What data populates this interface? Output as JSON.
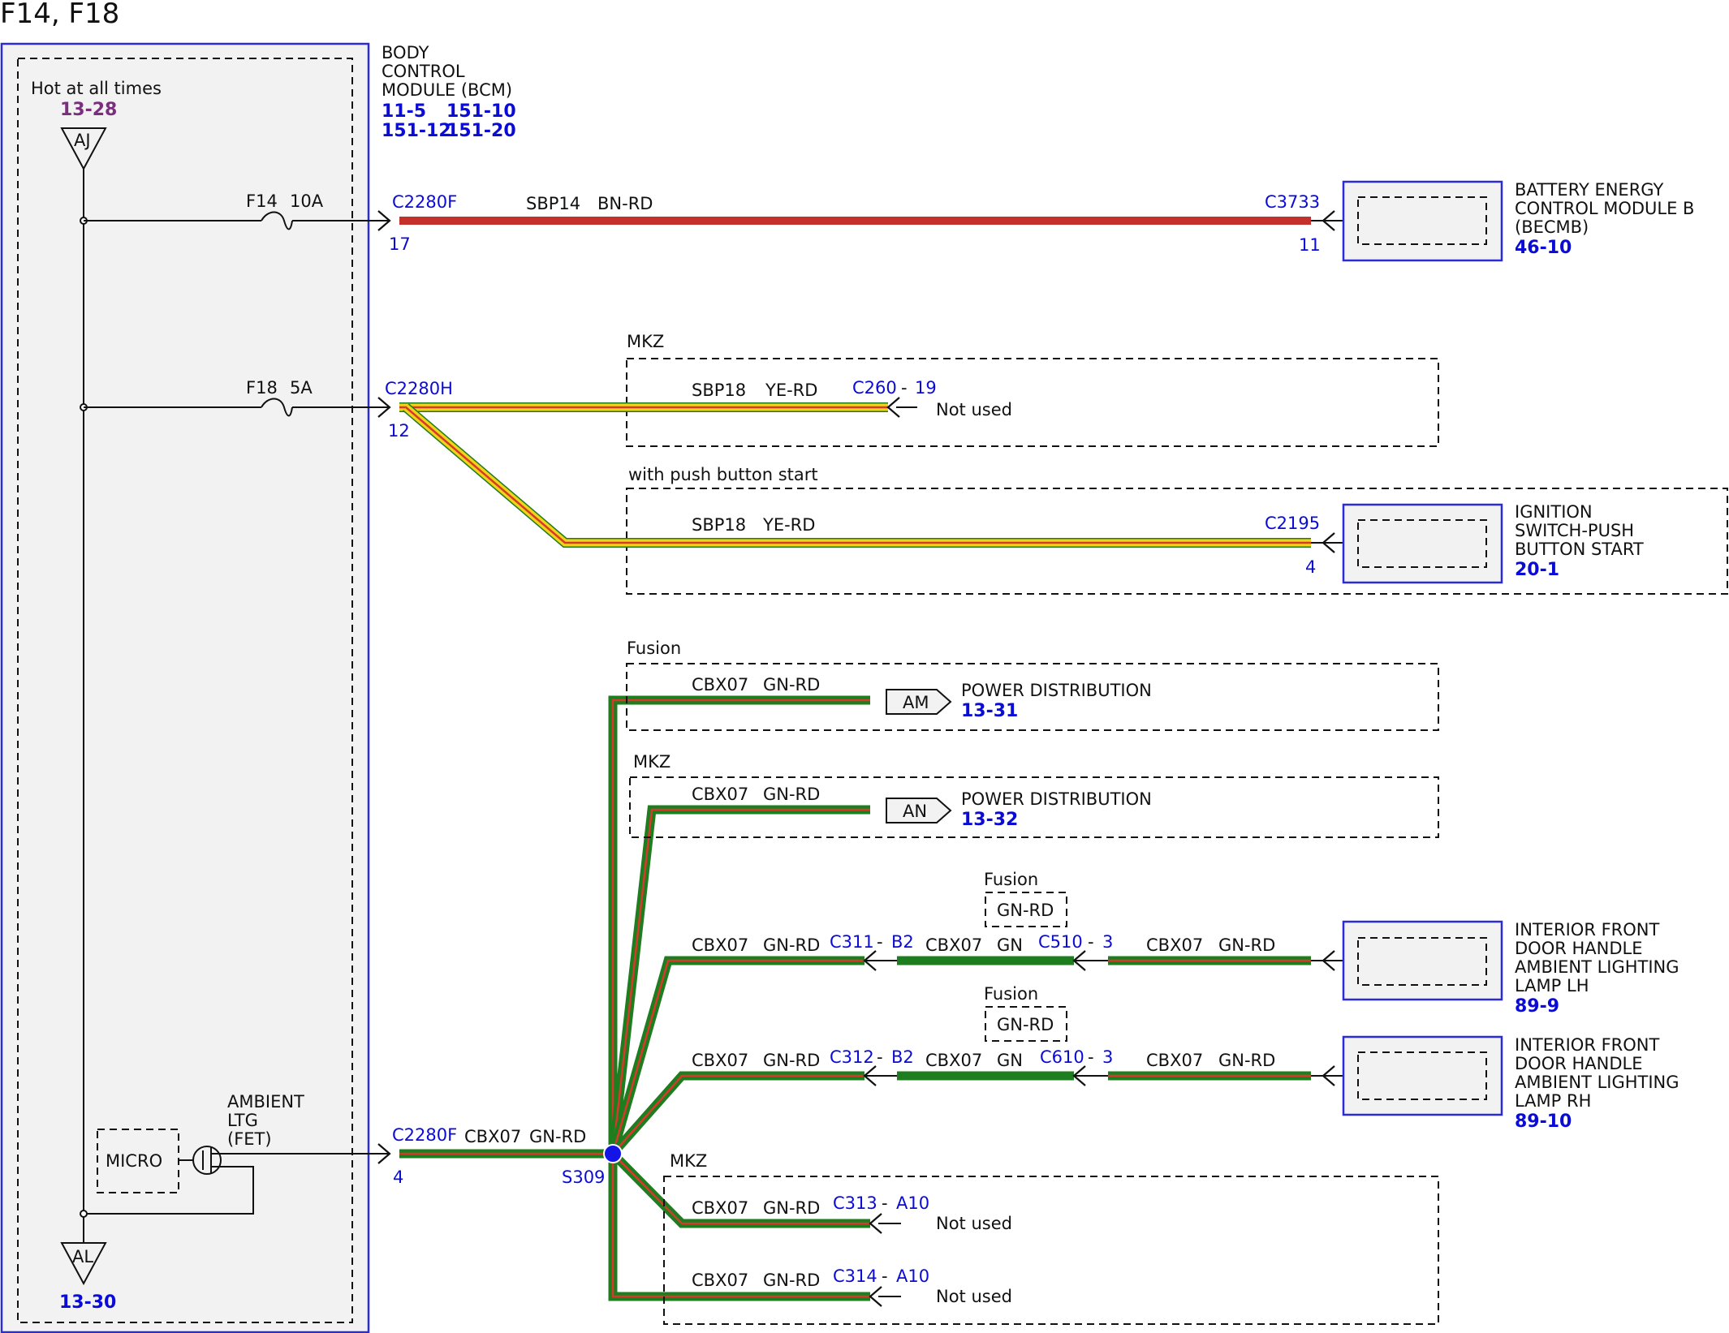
{
  "page_title": "F14, F18",
  "bcm": {
    "name": "BODY\nCONTROL\nMODULE (BCM)",
    "name_lines": [
      "BODY",
      "CONTROL",
      "MODULE (BCM)"
    ],
    "refs": [
      "11-5",
      "151-10",
      "151-12",
      "151-20"
    ],
    "hot_label": "Hot at all times",
    "hot_ref": "13-28",
    "top_connector": "AJ",
    "bottom_connector": "AL",
    "bottom_ref": "13-30",
    "micro_label": "MICRO",
    "fet_label_lines": [
      "AMBIENT",
      "LTG",
      "(FET)"
    ]
  },
  "fuses": [
    {
      "name": "F14",
      "rating": "10A",
      "connector": "C2280F",
      "pin": "17"
    },
    {
      "name": "F18",
      "rating": "5A",
      "connector": "C2280H",
      "pin": "12"
    }
  ],
  "circuit_f14": {
    "circuit": "SBP14",
    "color": "BN-RD",
    "dest_connector": "C3733",
    "dest_pin": "11",
    "dest_name_lines": [
      "BATTERY ENERGY",
      "CONTROL MODULE B",
      "(BECMB)"
    ],
    "dest_ref": "46-10"
  },
  "circuit_f18": {
    "mkz_label": "MKZ",
    "mkz_circuit": "SBP18",
    "mkz_color": "YE-RD",
    "mkz_connector": "C260",
    "mkz_pin": "19",
    "mkz_status": "Not used",
    "pbs_label": "with push button start",
    "pbs_circuit": "SBP18",
    "pbs_color": "YE-RD",
    "pbs_connector": "C2195",
    "pbs_pin": "4",
    "pbs_dest_lines": [
      "IGNITION",
      "SWITCH-PUSH",
      "BUTTON START"
    ],
    "pbs_dest_ref": "20-1"
  },
  "circuit_ambient": {
    "connector": "C2280F",
    "pin": "4",
    "circuit": "CBX07",
    "color": "GN-RD",
    "splice": "S309",
    "branches": [
      {
        "group": "Fusion",
        "circuit": "CBX07",
        "color": "GN-RD",
        "connector": "AM",
        "dest": "POWER DISTRIBUTION",
        "ref": "13-31"
      },
      {
        "group": "MKZ",
        "circuit": "CBX07",
        "color": "GN-RD",
        "connector": "AN",
        "dest": "POWER DISTRIBUTION",
        "ref": "13-32"
      }
    ],
    "lh": {
      "circuit": "CBX07",
      "color": "GN-RD",
      "inline1": "C311",
      "inline1_pin": "B2",
      "mid_circuit": "CBX07",
      "mid_color": "GN",
      "fusion_label": "Fusion",
      "fusion_color": "GN-RD",
      "inline2": "C510",
      "inline2_pin": "3",
      "end_circuit": "CBX07",
      "end_color": "GN-RD",
      "dest_lines": [
        "INTERIOR FRONT",
        "DOOR HANDLE",
        "AMBIENT LIGHTING",
        "LAMP LH"
      ],
      "dest_ref": "89-9"
    },
    "rh": {
      "circuit": "CBX07",
      "color": "GN-RD",
      "inline1": "C312",
      "inline1_pin": "B2",
      "mid_circuit": "CBX07",
      "mid_color": "GN",
      "fusion_label": "Fusion",
      "fusion_color": "GN-RD",
      "inline2": "C610",
      "inline2_pin": "3",
      "end_circuit": "CBX07",
      "end_color": "GN-RD",
      "dest_lines": [
        "INTERIOR FRONT",
        "DOOR HANDLE",
        "AMBIENT LIGHTING",
        "LAMP RH"
      ],
      "dest_ref": "89-10"
    },
    "unused": {
      "group": "MKZ",
      "items": [
        {
          "circuit": "CBX07",
          "color": "GN-RD",
          "connector": "C313",
          "pin": "A10",
          "status": "Not used"
        },
        {
          "circuit": "CBX07",
          "color": "GN-RD",
          "connector": "C314",
          "pin": "A10",
          "status": "Not used"
        }
      ]
    }
  },
  "colors": {
    "module_border": "#2b2bd8",
    "module_fill": "#f2f2f2",
    "wire_brown": "#c4302b",
    "wire_yellow": "#f2d21a",
    "wire_red": "#d63a2a",
    "wire_green": "#1e7d1e",
    "splice": "#1414e6"
  }
}
